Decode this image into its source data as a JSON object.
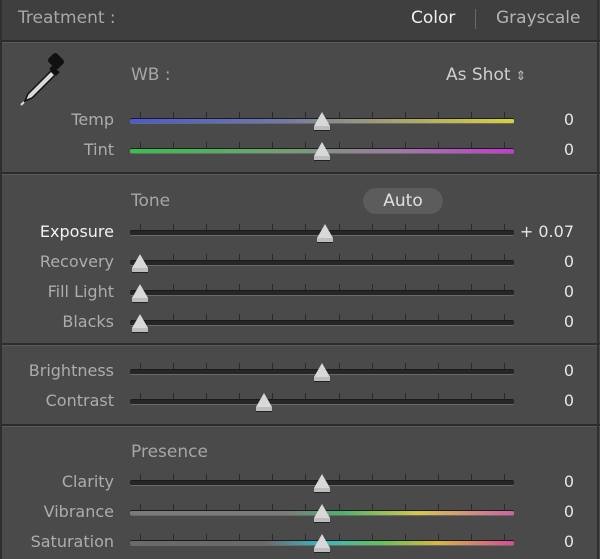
{
  "header": {
    "treatment_label": "Treatment :",
    "color_label": "Color",
    "grayscale_label": "Grayscale"
  },
  "wb": {
    "label": "WB :",
    "value": "As Shot",
    "updown_glyph": "⇕",
    "temp": {
      "label": "Temp",
      "value": "0",
      "position": 0.5
    },
    "tint": {
      "label": "Tint",
      "value": "0",
      "position": 0.5
    }
  },
  "tone": {
    "title": "Tone",
    "auto_label": "Auto",
    "exposure": {
      "label": "Exposure",
      "value": "+ 0.07",
      "position": 0.507
    },
    "recovery": {
      "label": "Recovery",
      "value": "0",
      "position": 0.0
    },
    "fill_light": {
      "label": "Fill Light",
      "value": "0",
      "position": 0.0
    },
    "blacks": {
      "label": "Blacks",
      "value": "0",
      "position": 0.0
    },
    "brightness": {
      "label": "Brightness",
      "value": "0",
      "position": 0.5
    },
    "contrast": {
      "label": "Contrast",
      "value": "0",
      "position": 0.34
    }
  },
  "presence": {
    "title": "Presence",
    "clarity": {
      "label": "Clarity",
      "value": "0",
      "position": 0.5
    },
    "vibrance": {
      "label": "Vibrance",
      "value": "0",
      "position": 0.5
    },
    "saturation": {
      "label": "Saturation",
      "value": "0",
      "position": 0.5
    }
  }
}
